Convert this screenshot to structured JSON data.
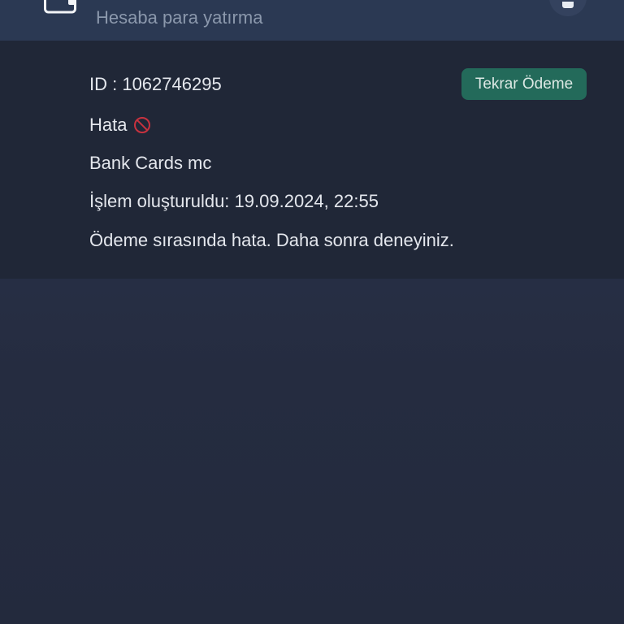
{
  "header": {
    "title": "Hesaba para yatırma",
    "left_icon": "wallet-icon",
    "right_icon": "notification-icon"
  },
  "transaction": {
    "id_label": "ID : 1062746295",
    "status": "Hata",
    "status_icon": "prohibited-icon",
    "payment_method": "Bank Cards mc",
    "created_label": "İşlem oluşturuldu:",
    "created_at": "19.09.2024, 22:55",
    "message": "Ödeme sırasında hata. Daha sonra deneyiniz.",
    "retry_label": "Tekrar Ödeme"
  },
  "colors": {
    "background": "#252c40",
    "card": "#202737",
    "header": "#2b3953",
    "accent_button": "#236a5a",
    "error_icon": "#c8323f"
  }
}
